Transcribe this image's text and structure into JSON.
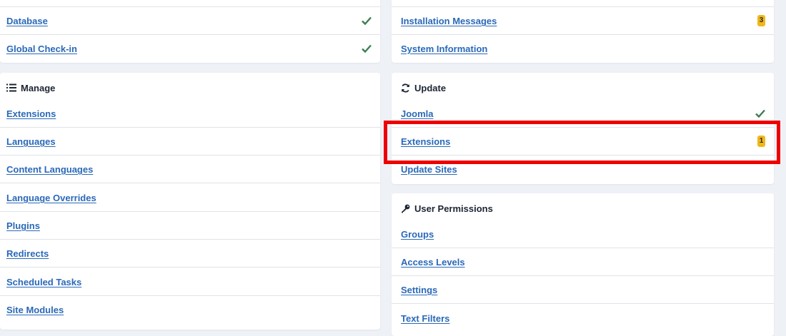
{
  "system": {
    "items": [
      {
        "label": "Database",
        "status": "ok"
      },
      {
        "label": "Global Check-in",
        "status": "ok"
      }
    ]
  },
  "information": {
    "items": [
      {
        "label": "Installation Messages",
        "badge": "3"
      },
      {
        "label": "System Information"
      }
    ]
  },
  "manage": {
    "title": "Manage",
    "icon": "list-icon",
    "items": [
      {
        "label": "Extensions"
      },
      {
        "label": "Languages"
      },
      {
        "label": "Content Languages"
      },
      {
        "label": "Language Overrides"
      },
      {
        "label": "Plugins"
      },
      {
        "label": "Redirects"
      },
      {
        "label": "Scheduled Tasks"
      },
      {
        "label": "Site Modules"
      }
    ]
  },
  "update": {
    "title": "Update",
    "icon": "sync-icon",
    "items": [
      {
        "label": "Joomla",
        "status": "ok"
      },
      {
        "label": "Extensions",
        "badge": "1",
        "highlighted": true
      },
      {
        "label": "Update Sites"
      }
    ]
  },
  "user_permissions": {
    "title": "User Permissions",
    "icon": "key-icon",
    "items": [
      {
        "label": "Groups"
      },
      {
        "label": "Access Levels"
      },
      {
        "label": "Settings"
      },
      {
        "label": "Text Filters"
      }
    ]
  },
  "colors": {
    "link": "#2a69b8",
    "check": "#3d7e52",
    "badge": "#f0b71a",
    "highlight": "#ee0000",
    "background": "#eef1f6"
  }
}
